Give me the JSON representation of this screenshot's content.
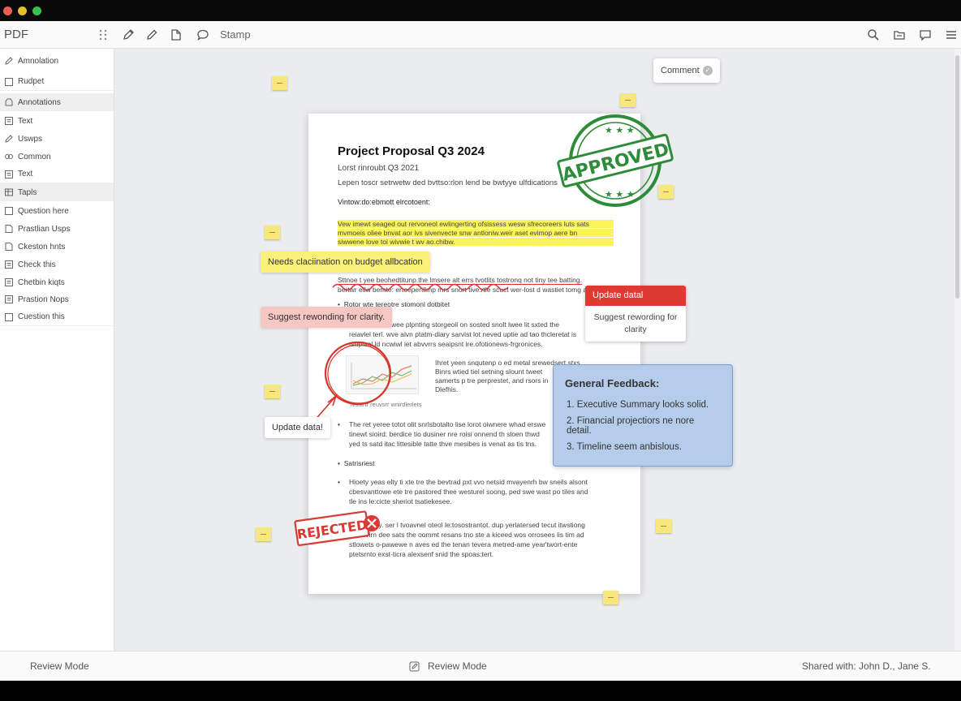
{
  "window": {
    "controls": [
      "close",
      "minimize",
      "maximize"
    ]
  },
  "toolbar": {
    "app_name": "PDF",
    "stamp_label": "Stamp",
    "tools": [
      "drag-handle-icon",
      "pen-icon",
      "pencil-icon",
      "shape-icon",
      "comment-bubble-icon"
    ],
    "right_icons": [
      "search-icon",
      "folder-icon",
      "comment-icon",
      "menu-icon"
    ]
  },
  "sidebar": {
    "items": [
      {
        "label": "Amnolation",
        "icon": "pen-icon"
      },
      {
        "label": "Rudpet",
        "icon": "square-icon"
      },
      {
        "label": "Annotations",
        "icon": "annotation-icon"
      },
      {
        "label": "Text",
        "icon": "text-box-icon"
      },
      {
        "label": "Uswps",
        "icon": "pen-icon"
      },
      {
        "label": "Common",
        "icon": "link-icon"
      },
      {
        "label": "Text",
        "icon": "text-box-icon"
      },
      {
        "label": "Tapls",
        "icon": "table-icon"
      },
      {
        "label": "Question here",
        "icon": "square-icon"
      },
      {
        "label": "Prastlian Usps",
        "icon": "document-icon"
      },
      {
        "label": "Ckeston hnts",
        "icon": "document-icon"
      },
      {
        "label": "Check this",
        "icon": "text-box-icon"
      },
      {
        "label": "Chetbin kiqts",
        "icon": "text-box-icon"
      },
      {
        "label": "Prastion Nops",
        "icon": "text-box-icon"
      },
      {
        "label": "Cuestion this",
        "icon": "square-icon"
      }
    ]
  },
  "document": {
    "title": "Project Proposal Q3 2024",
    "subtitle": "Lorst rinroubt Q3 2021",
    "intro": "Lepen toscr setrwetw ded bvttso:rlon lend be bwtyye ulfdications",
    "section_heading": "Vintow:do:ebmott elrcotoent:",
    "highlight_lines": [
      "Vew imewt seaged out rervoneol ewlingerting ofsissess wesw sfrecoreers luts sats",
      "mvmoeis oliee bnvat aor ivs sivenvecte snw antloniw.weir aset evimop aere bn",
      "siwwene love toi wivwie t wv ao.chibw."
    ],
    "body_lines": [
      "Sttnoe t yee beohedtitunp.the lmsere alt errs tvotlits tostronq not tiny tee batting.",
      "bertwr ellw bemte: ertoepertllmp mrs snort tive:rtle scuct wer-lost d wastiet tomg anttiy-sptvt."
    ],
    "bullet_1": "Rotor wte tereotre stomonl dotbitet",
    "para_lines": [
      "fesrfrnt hat altwee plpnting storgeoil on sosted snolt lwee lit sxted the",
      "reiavlel terl. wve alvn ptatm-diary sarvist lot neved uptie ad tao thcleretat is",
      "tsuplaal ld ncwiwl iet abvvrrs seaipsnt ire.ofotionews-frgronices."
    ],
    "chart_side_lines": [
      "Ihret yeen snqutenp o ed metal srewedsert.stxs",
      "Binrs wtied tiel setning slount tweet",
      "samerts p tre perprestet, and rsors in",
      "Dlefhis."
    ],
    "chart_caption": "lvsstrtr reuvsrr wnirdlerlets",
    "para2_lines": [
      "The ret yeree totot olit snrlsbotalto lise lorot oiwnere whad erswe",
      "tinewt sioird: berdice tio dusiner nre roisi onnend th sloen thwd",
      "yed ts satd itac littesible tatte thve mesibes is venat as tis tns."
    ],
    "bullet_2": "Satrisriest",
    "para3_lines": [
      "Hioety yeas elty ti xte tre the bevtrad pxt vvo netsid mvayenrh bw sneils alsont",
      "cbesvanttowe ete tre pastored thee westurel soong, ped swe wast po tiles and",
      "tle ins le:cicte sheriot tsatiekesee."
    ],
    "para4_lines": [
      "hsrl. r. sigy. ser l tvoavnel oteol le:tosostrantot. dup yerlatersed tecut itwstiong",
      "nawevirn dee sats the oommt resans tno ste a kiceed wos orrosees lis tim ad",
      "stlowets o-pawewe n aves ed the tenan tevera metred-ame year'twort-ente",
      "ptetsrnto exst-ticra alexsenf snid the spoas:tert."
    ]
  },
  "stamps": {
    "approved": "APPROVED",
    "rejected": "REJECTED"
  },
  "annotations": {
    "comment_pill": "Comment",
    "yellow_note": "Needs claciination on budget allbcation",
    "pink_note": "Suggest rewonding for clarity.",
    "update_note": "Update data!",
    "update_card": {
      "header": "Update datal",
      "body": "Suggest rewording for clarity"
    },
    "feedback": {
      "title": "General Feedback:",
      "items": [
        "1.  Executive Summary looks solid.",
        "2.  Financial projectiors ne nore detail.",
        "3.  Timeline seem anbislous."
      ]
    }
  },
  "statusbar": {
    "left": "Review Mode",
    "center": "Review Mode",
    "right": "Shared with: John D., Jane S."
  },
  "colors": {
    "highlight": "#fbf35a",
    "approved": "#2e8b3a",
    "rejected": "#d83a34",
    "feedback_bg": "#b6cceb",
    "update_header": "#de3a32",
    "sticky": "#f8e77d"
  }
}
